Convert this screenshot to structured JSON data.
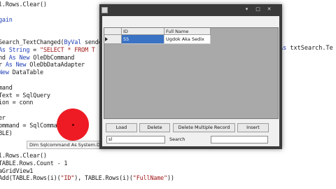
{
  "editor": {
    "lines": [
      {
        "parts": [
          {
            "t": "l.Rows.Clear()",
            "c": ""
          }
        ]
      },
      {
        "parts": [
          {
            "t": "",
            "c": ""
          }
        ]
      },
      {
        "parts": [
          {
            "t": "gain",
            "c": "kw"
          }
        ]
      },
      {
        "parts": [
          {
            "t": "",
            "c": ""
          }
        ]
      },
      {
        "parts": [
          {
            "t": "",
            "c": ""
          }
        ]
      },
      {
        "parts": [
          {
            "t": "Search_TextChanged(",
            "c": ""
          },
          {
            "t": "ByVal",
            "c": "kw"
          },
          {
            "t": " sende",
            "c": ""
          }
        ]
      },
      {
        "parts": [
          {
            "t": "As String",
            "c": "kw"
          },
          {
            "t": " = ",
            "c": ""
          },
          {
            "t": "\"SELECT * FROM T",
            "c": "str"
          }
        ]
      },
      {
        "parts": [
          {
            "t": "nd ",
            "c": ""
          },
          {
            "t": "As New",
            "c": "kw"
          },
          {
            "t": " OleDbCommand",
            "c": ""
          }
        ]
      },
      {
        "parts": [
          {
            "t": "r ",
            "c": ""
          },
          {
            "t": "As New",
            "c": "kw"
          },
          {
            "t": " OleDbDataAdapter",
            "c": ""
          }
        ]
      },
      {
        "parts": [
          {
            "t": "New",
            "c": "kw"
          },
          {
            "t": " DataTable",
            "c": ""
          }
        ]
      },
      {
        "parts": [
          {
            "t": "",
            "c": ""
          }
        ]
      },
      {
        "parts": [
          {
            "t": "mand",
            "c": ""
          }
        ]
      },
      {
        "parts": [
          {
            "t": "Text = SqlQuery",
            "c": ""
          }
        ]
      },
      {
        "parts": [
          {
            "t": "ion = conn",
            "c": ""
          }
        ]
      },
      {
        "parts": [
          {
            "t": "",
            "c": ""
          }
        ]
      },
      {
        "parts": [
          {
            "t": "er",
            "c": ""
          }
        ]
      },
      {
        "parts": [
          {
            "t": "ommand = SqlCommand",
            "c": ""
          }
        ]
      },
      {
        "parts": [
          {
            "t": "BLE)",
            "c": ""
          }
        ]
      },
      {
        "parts": [
          {
            "t": "",
            "c": ""
          }
        ]
      },
      {
        "parts": [
          {
            "t": "",
            "c": ""
          }
        ]
      },
      {
        "parts": [
          {
            "t": "l.Rows.Clear()",
            "c": ""
          }
        ]
      },
      {
        "parts": [
          {
            "t": "TABLE.Rows.Count - 1",
            "c": ""
          }
        ]
      },
      {
        "parts": [
          {
            "t": "aGridView1",
            "c": ""
          }
        ]
      },
      {
        "parts": [
          {
            "t": "Add(TABLE.Rows(i)(",
            "c": ""
          },
          {
            "t": "\"ID\"",
            "c": "str"
          },
          {
            "t": "), TABLE.Rows(i)(",
            "c": ""
          },
          {
            "t": "\"FullName\"",
            "c": "str"
          },
          {
            "t": "))",
            "c": ""
          }
        ]
      }
    ],
    "right_fragment_kw": "As ",
    "right_fragment_rest": "txtSearch.Te",
    "tooltip": "Dim Sqlcommand As System.Data.OleDb.OleDbCommand"
  },
  "form": {
    "minimize_icon": "▾",
    "maximize_icon": "□",
    "close_icon": "✕",
    "grid": {
      "columns": [
        "ID",
        "Full Name"
      ],
      "rows": [
        {
          "id": "55",
          "full_name": "Ugdok Aka Sedix"
        }
      ]
    },
    "buttons": {
      "load": "Load",
      "delete": "Delete",
      "delete_multiple": "Delete Multiple Record",
      "insert": "Insert"
    },
    "search": {
      "label": "Search",
      "left_value": "sl",
      "right_value": ""
    }
  },
  "colors": {
    "window_dark": "#3a3a3a",
    "selection": "#3a72c4",
    "click_marker": "#ee1b24",
    "keyword": "#1f3fb5"
  }
}
